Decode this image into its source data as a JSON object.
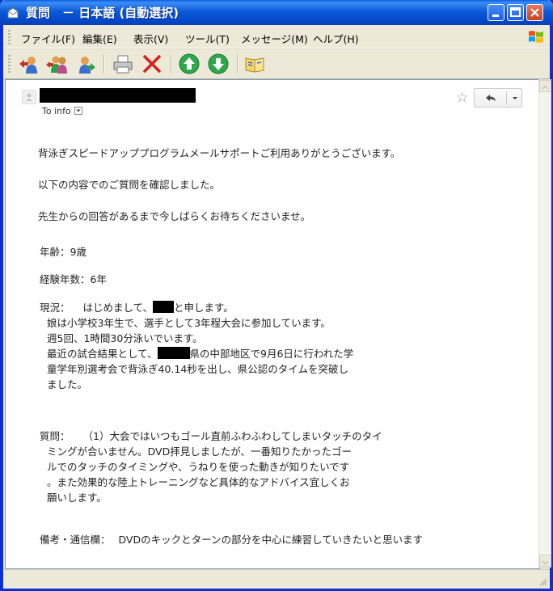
{
  "window": {
    "title": "質問　－ 日本語 (自動選択)"
  },
  "menu": {
    "items": [
      "ファイル(F)",
      "編集(E)",
      "表示(V)",
      "ツール(T)",
      "メッセージ(M)",
      "ヘルプ(H)"
    ]
  },
  "toolbar": {
    "icons": [
      "reply-icon",
      "reply-all-icon",
      "forward-icon",
      "print-icon",
      "delete-icon",
      "previous-icon",
      "next-icon",
      "address-book-icon"
    ]
  },
  "header": {
    "to_label": "To info",
    "sender": ""
  },
  "message": {
    "line1": "背泳ぎスピードアッププログラムメールサポートご利用ありがとうございます。",
    "line2": "以下の内容でのご質問を確認しました。",
    "line3": "先生からの回答があるまで今しばらくお待ちくださいませ。",
    "age": "年齢：9歳",
    "experience": "経験年数：6年",
    "status_label": "現況：",
    "status_1a": "はじめまして、",
    "status_1b": "と申します。",
    "status_2": "娘は小学校3年生で、選手として3年程大会に参加しています。",
    "status_3": "週5回、1時間30分泳いでいます。",
    "status_4a": "最近の試合結果として、",
    "status_4b": "県の中部地区で9月6日に行われた学",
    "status_5": "童学年別選考会で背泳ぎ40.14秒を出し、県公認のタイムを突破し",
    "status_6": "ました。",
    "question_label": "質問：",
    "question_1": "（1）大会ではいつもゴール直前ふわふわしてしまいタッチのタイ",
    "question_2": "ミングが合いません。DVD拝見しましたが、一番知りたかったゴー",
    "question_3": "ルでのタッチのタイミングや、うねりを使った動きが知りたいです",
    "question_4": "。また効果的な陸上トレーニングなど具体的なアドバイス宜しくお",
    "question_5": "願いします。",
    "remarks_label": "備考・通信欄：",
    "remarks_text": "DVDのキックとターンの部分を中心に練習していきたいと思います"
  },
  "colors": {
    "titlebar": "#0b5bd9",
    "chrome": "#ece9d8",
    "text": "#222222"
  }
}
